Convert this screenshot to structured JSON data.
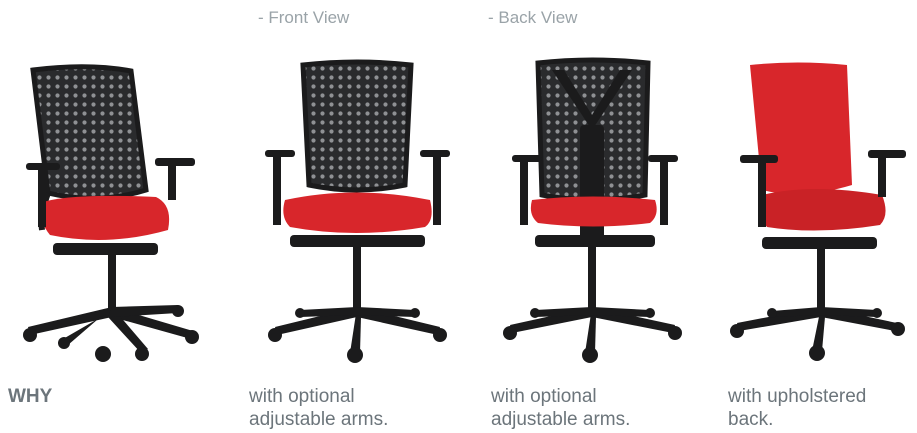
{
  "view_labels": {
    "front": "- Front View",
    "back": "- Back View"
  },
  "captions": [
    {
      "lines": [
        "WHY"
      ]
    },
    {
      "lines": [
        "with optional",
        "adjustable arms."
      ]
    },
    {
      "lines": [
        "with optional",
        "adjustable arms."
      ]
    },
    {
      "lines": [
        "with upholstered",
        "back."
      ]
    }
  ],
  "colors": {
    "seat_red": "#d8262b",
    "frame_black": "#1b1b1c",
    "mesh_grey": "#3a3b3d",
    "label_grey": "#9aa3a8",
    "caption_grey": "#6c757b"
  }
}
